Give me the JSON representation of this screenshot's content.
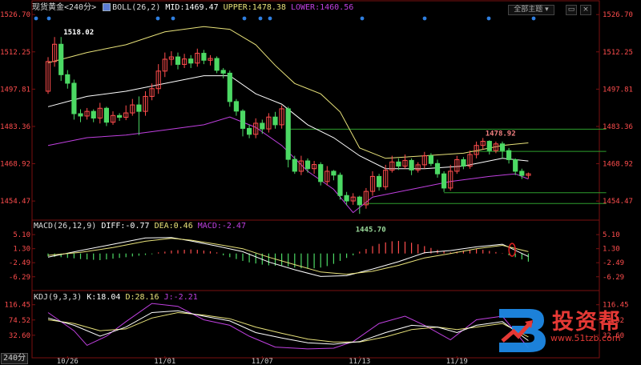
{
  "header": {
    "instrument": "现货黄金",
    "period": "<240分>",
    "indicator_label": "BOLL(26,2)",
    "mid": "MID:1469.47",
    "upper": "UPPER:1478.38",
    "lower": "LOWER:1460.56",
    "view_button": "全部主题",
    "period_tab": "240分"
  },
  "colors": {
    "up_candle": "#ff4d4d",
    "down_candle": "#4cd964",
    "boll_mid": "#ffffff",
    "boll_upper": "#e8e27a",
    "boll_lower": "#c040e0",
    "macd_diff": "#ffffff",
    "macd_dea": "#e8e27a",
    "kdj_k": "#ffffff",
    "kdj_d": "#e8e27a",
    "kdj_j": "#c040e0",
    "hline": "#2e9e2e",
    "axis_text": "#ff4d4d"
  },
  "chart_data": [
    {
      "type": "candlestick",
      "panel": "price",
      "ylim": [
        1448,
        1528
      ],
      "y_ticks": [
        1526.7,
        1512.25,
        1497.81,
        1483.36,
        1468.92,
        1454.47
      ],
      "x_labels": [
        "10/26",
        "11/01",
        "11/07",
        "11/13",
        "11/19"
      ],
      "x_label_index": [
        3,
        18,
        33,
        48,
        63
      ],
      "annotations": [
        {
          "text": "1518.02",
          "index": 2,
          "value": 1518.02
        },
        {
          "text": "1478.92",
          "index": 67,
          "value": 1478.92
        },
        {
          "text": "1445.70",
          "index": 47,
          "value": 1445.7
        }
      ],
      "hlines": [
        {
          "value": 1482.3,
          "from": 37,
          "to": 86
        },
        {
          "value": 1473.7,
          "from": 65,
          "to": 86
        },
        {
          "value": 1457.7,
          "from": 61,
          "to": 86
        },
        {
          "value": 1453.5,
          "from": 49,
          "to": 86
        }
      ],
      "candles": [
        [
          1497.0,
          1508.5,
          1497.0,
          1510.2,
          1496.0
        ],
        [
          1508.5,
          1515.2,
          1507.8,
          1518.0,
          1506.5
        ],
        [
          1515.2,
          1503.4,
          1502.6,
          1518.0,
          1501.0
        ],
        [
          1503.4,
          1500.1,
          1498.5,
          1505.2,
          1498.0
        ],
        [
          1500.1,
          1488.3,
          1487.0,
          1501.5,
          1486.0
        ],
        [
          1488.3,
          1487.4,
          1486.0,
          1490.0,
          1485.0
        ],
        [
          1487.4,
          1489.2,
          1486.8,
          1490.5,
          1486.0
        ],
        [
          1489.2,
          1486.6,
          1485.5,
          1490.0,
          1485.0
        ],
        [
          1486.6,
          1490.4,
          1485.8,
          1492.5,
          1484.5
        ],
        [
          1490.4,
          1485.0,
          1483.8,
          1491.0,
          1483.5
        ],
        [
          1485.0,
          1487.6,
          1484.5,
          1489.2,
          1484.0
        ],
        [
          1487.6,
          1486.9,
          1485.9,
          1488.5,
          1485.5
        ],
        [
          1486.9,
          1488.6,
          1486.2,
          1491.5,
          1485.8
        ],
        [
          1488.6,
          1491.7,
          1488.2,
          1494.0,
          1487.5
        ],
        [
          1491.7,
          1489.2,
          1488.8,
          1495.0,
          1480.0
        ],
        [
          1489.2,
          1495.0,
          1488.9,
          1497.0,
          1487.5
        ],
        [
          1495.0,
          1498.0,
          1494.2,
          1500.0,
          1493.5
        ],
        [
          1498.0,
          1504.8,
          1497.4,
          1507.5,
          1496.0
        ],
        [
          1504.8,
          1509.4,
          1503.6,
          1512.0,
          1502.5
        ],
        [
          1509.4,
          1510.3,
          1508.4,
          1512.5,
          1507.0
        ],
        [
          1510.3,
          1507.4,
          1506.1,
          1512.0,
          1505.5
        ],
        [
          1507.4,
          1509.5,
          1506.8,
          1511.5,
          1506.0
        ],
        [
          1509.5,
          1507.9,
          1506.8,
          1511.0,
          1506.0
        ],
        [
          1507.9,
          1511.7,
          1507.2,
          1513.5,
          1506.5
        ],
        [
          1511.7,
          1509.0,
          1508.1,
          1513.0,
          1507.5
        ],
        [
          1509.0,
          1509.7,
          1507.3,
          1511.0,
          1507.0
        ],
        [
          1509.7,
          1505.1,
          1504.5,
          1510.5,
          1504.0
        ],
        [
          1505.1,
          1504.0,
          1502.6,
          1506.0,
          1502.0
        ],
        [
          1504.0,
          1493.0,
          1492.2,
          1505.0,
          1491.0
        ],
        [
          1493.0,
          1489.3,
          1488.2,
          1494.0,
          1487.5
        ],
        [
          1489.3,
          1482.6,
          1481.7,
          1490.0,
          1479.5
        ],
        [
          1482.6,
          1480.3,
          1479.4,
          1484.0,
          1478.8
        ],
        [
          1480.3,
          1484.6,
          1479.5,
          1486.5,
          1478.8
        ],
        [
          1484.6,
          1482.4,
          1481.5,
          1486.0,
          1480.5
        ],
        [
          1482.4,
          1487.0,
          1481.8,
          1488.5,
          1481.0
        ],
        [
          1487.0,
          1484.0,
          1483.0,
          1489.0,
          1482.5
        ],
        [
          1484.0,
          1490.2,
          1483.4,
          1491.5,
          1482.5
        ],
        [
          1490.2,
          1470.6,
          1470.0,
          1491.0,
          1467.5
        ],
        [
          1470.6,
          1466.0,
          1465.4,
          1472.0,
          1465.0
        ],
        [
          1466.0,
          1470.0,
          1465.2,
          1472.0,
          1464.5
        ],
        [
          1470.0,
          1467.0,
          1466.3,
          1471.0,
          1465.5
        ],
        [
          1467.0,
          1468.6,
          1465.6,
          1470.0,
          1465.0
        ],
        [
          1468.6,
          1462.0,
          1461.4,
          1469.5,
          1460.5
        ],
        [
          1462.0,
          1466.0,
          1461.4,
          1468.0,
          1460.5
        ],
        [
          1466.0,
          1464.5,
          1463.1,
          1466.5,
          1462.5
        ],
        [
          1464.5,
          1456.6,
          1455.8,
          1465.5,
          1455.0
        ],
        [
          1456.6,
          1454.5,
          1453.5,
          1458.0,
          1452.8
        ],
        [
          1454.5,
          1456.0,
          1453.7,
          1457.5,
          1453.0
        ],
        [
          1456.0,
          1453.0,
          1452.5,
          1456.5,
          1449.5
        ],
        [
          1453.0,
          1458.2,
          1452.2,
          1459.5,
          1451.5
        ],
        [
          1458.2,
          1464.0,
          1457.6,
          1466.0,
          1456.5
        ],
        [
          1464.0,
          1460.0,
          1459.2,
          1465.0,
          1458.5
        ],
        [
          1460.0,
          1466.4,
          1459.7,
          1468.5,
          1458.8
        ],
        [
          1466.4,
          1469.6,
          1466.0,
          1472.0,
          1465.5
        ],
        [
          1469.6,
          1468.0,
          1467.5,
          1471.0,
          1466.5
        ],
        [
          1468.0,
          1470.2,
          1467.6,
          1472.5,
          1467.0
        ],
        [
          1470.2,
          1466.5,
          1465.5,
          1471.0,
          1464.5
        ],
        [
          1466.5,
          1468.5,
          1465.8,
          1469.5,
          1465.5
        ],
        [
          1468.5,
          1472.0,
          1467.6,
          1473.5,
          1467.0
        ],
        [
          1472.0,
          1469.0,
          1468.5,
          1473.0,
          1468.0
        ],
        [
          1469.0,
          1465.0,
          1464.2,
          1470.5,
          1463.5
        ],
        [
          1465.0,
          1459.5,
          1458.5,
          1466.0,
          1458.0
        ],
        [
          1459.5,
          1466.0,
          1459.4,
          1468.5,
          1458.5
        ],
        [
          1466.0,
          1470.5,
          1465.6,
          1472.0,
          1465.0
        ],
        [
          1470.5,
          1468.0,
          1467.0,
          1471.5,
          1466.8
        ],
        [
          1468.0,
          1472.5,
          1467.7,
          1474.0,
          1467.0
        ],
        [
          1472.5,
          1476.0,
          1471.8,
          1477.5,
          1471.0
        ],
        [
          1476.0,
          1477.6,
          1475.2,
          1478.9,
          1474.5
        ],
        [
          1477.6,
          1474.0,
          1473.0,
          1478.0,
          1472.5
        ],
        [
          1474.0,
          1476.6,
          1473.6,
          1477.5,
          1473.0
        ],
        [
          1476.6,
          1474.0,
          1473.4,
          1477.5,
          1471.0
        ],
        [
          1474.0,
          1470.5,
          1469.7,
          1475.0,
          1469.0
        ],
        [
          1470.5,
          1466.0,
          1465.0,
          1471.0,
          1464.5
        ],
        [
          1466.0,
          1464.4,
          1463.4,
          1467.0,
          1463.0
        ],
        [
          1464.4,
          1465.0,
          1463.5,
          1465.5,
          1463.2
        ]
      ],
      "boll_upper_points": [
        [
          0,
          1508
        ],
        [
          6,
          1512
        ],
        [
          12,
          1515
        ],
        [
          18,
          1520
        ],
        [
          24,
          1522
        ],
        [
          28,
          1521
        ],
        [
          32,
          1515
        ],
        [
          35,
          1507
        ],
        [
          38,
          1500
        ],
        [
          42,
          1496
        ],
        [
          45,
          1489
        ],
        [
          48,
          1475
        ],
        [
          52,
          1471
        ],
        [
          58,
          1472
        ],
        [
          64,
          1473
        ],
        [
          70,
          1476
        ],
        [
          74,
          1477
        ]
      ],
      "boll_mid_points": [
        [
          0,
          1491
        ],
        [
          6,
          1495
        ],
        [
          12,
          1497
        ],
        [
          18,
          1500
        ],
        [
          24,
          1503
        ],
        [
          28,
          1503
        ],
        [
          32,
          1496
        ],
        [
          36,
          1492
        ],
        [
          40,
          1484
        ],
        [
          44,
          1479
        ],
        [
          48,
          1472
        ],
        [
          52,
          1467
        ],
        [
          58,
          1467
        ],
        [
          64,
          1468
        ],
        [
          70,
          1471
        ],
        [
          74,
          1470
        ]
      ],
      "boll_lower_points": [
        [
          0,
          1476
        ],
        [
          6,
          1479
        ],
        [
          12,
          1480
        ],
        [
          18,
          1482
        ],
        [
          24,
          1484
        ],
        [
          28,
          1487
        ],
        [
          32,
          1483
        ],
        [
          36,
          1476
        ],
        [
          40,
          1466
        ],
        [
          44,
          1459
        ],
        [
          47,
          1450
        ],
        [
          50,
          1456
        ],
        [
          56,
          1459
        ],
        [
          62,
          1462
        ],
        [
          68,
          1464
        ],
        [
          72,
          1465
        ],
        [
          74,
          1463
        ]
      ]
    },
    {
      "type": "macd",
      "panel": "macd",
      "title": "MACD(26,12,9)",
      "diff_label": "DIFF:-0.77",
      "dea_label": "DEA:0.46",
      "macd_label": "MACD:-2.47",
      "ylim": [
        -8.5,
        7.5
      ],
      "y_ticks": [
        5.1,
        1.3,
        -2.49,
        -6.29
      ],
      "diff_points": [
        [
          0,
          -1
        ],
        [
          5,
          0.8
        ],
        [
          10,
          2.5
        ],
        [
          15,
          4.2
        ],
        [
          19,
          4.3
        ],
        [
          22,
          3.4
        ],
        [
          26,
          2.0
        ],
        [
          30,
          0.5
        ],
        [
          34,
          -2.3
        ],
        [
          38,
          -4.4
        ],
        [
          42,
          -6.2
        ],
        [
          46,
          -6.0
        ],
        [
          50,
          -4.2
        ],
        [
          54,
          -2.2
        ],
        [
          58,
          0.2
        ],
        [
          62,
          0.8
        ],
        [
          66,
          1.8
        ],
        [
          70,
          2.5
        ],
        [
          74,
          -0.8
        ]
      ],
      "dea_points": [
        [
          0,
          -0.5
        ],
        [
          5,
          0.3
        ],
        [
          10,
          1.6
        ],
        [
          15,
          3.3
        ],
        [
          19,
          4.1
        ],
        [
          22,
          3.6
        ],
        [
          26,
          2.5
        ],
        [
          30,
          1.3
        ],
        [
          34,
          -1.0
        ],
        [
          38,
          -3.0
        ],
        [
          42,
          -5.0
        ],
        [
          46,
          -5.6
        ],
        [
          50,
          -4.8
        ],
        [
          54,
          -3.2
        ],
        [
          58,
          -1.2
        ],
        [
          62,
          0.0
        ],
        [
          66,
          1.3
        ],
        [
          70,
          2.2
        ],
        [
          74,
          0.5
        ]
      ],
      "histogram": [
        -0.8,
        -0.9,
        -1.0,
        -1.2,
        -1.3,
        -1.5,
        -1.6,
        -1.7,
        -1.8,
        -1.6,
        -1.4,
        -1.2,
        -1.0,
        -0.8,
        -0.6,
        -0.4,
        -0.2,
        0.3,
        0.5,
        0.8,
        0.9,
        1.0,
        1.1,
        1.0,
        0.8,
        0.6,
        0.3,
        -0.5,
        -1.0,
        -1.5,
        -2.0,
        -2.4,
        -2.7,
        -3.0,
        -3.2,
        -3.3,
        -3.2,
        -3.5,
        -3.8,
        -4.0,
        -4.1,
        -4.0,
        -3.8,
        -3.4,
        -2.8,
        -2.0,
        -1.2,
        -0.5,
        0.5,
        1.2,
        2.0,
        2.6,
        3.0,
        3.3,
        3.4,
        3.2,
        2.9,
        2.5,
        2.0,
        1.5,
        1.0,
        0.6,
        0.3,
        0.5,
        0.8,
        1.0,
        1.2,
        1.0,
        0.7,
        0.4,
        0.1,
        -0.5,
        -1.0,
        -1.6,
        -2.2
      ]
    },
    {
      "type": "kdj",
      "panel": "kdj",
      "title": "KDJ(9,3,3)",
      "k_label": "K:18.04",
      "d_label": "D:28.16",
      "j_label": "J:-2.21",
      "ylim": [
        -25,
        140
      ],
      "y_ticks": [
        116.45,
        74.52,
        32.6
      ],
      "k_points": [
        [
          0,
          80
        ],
        [
          4,
          60
        ],
        [
          8,
          30
        ],
        [
          12,
          55
        ],
        [
          16,
          95
        ],
        [
          20,
          100
        ],
        [
          24,
          85
        ],
        [
          28,
          72
        ],
        [
          32,
          40
        ],
        [
          36,
          25
        ],
        [
          40,
          12
        ],
        [
          44,
          8
        ],
        [
          48,
          15
        ],
        [
          52,
          40
        ],
        [
          56,
          60
        ],
        [
          60,
          55
        ],
        [
          63,
          40
        ],
        [
          66,
          60
        ],
        [
          70,
          70
        ],
        [
          74,
          18
        ]
      ],
      "d_points": [
        [
          0,
          75
        ],
        [
          4,
          65
        ],
        [
          8,
          45
        ],
        [
          12,
          50
        ],
        [
          16,
          80
        ],
        [
          20,
          95
        ],
        [
          24,
          88
        ],
        [
          28,
          78
        ],
        [
          32,
          55
        ],
        [
          36,
          38
        ],
        [
          40,
          22
        ],
        [
          44,
          14
        ],
        [
          48,
          14
        ],
        [
          52,
          28
        ],
        [
          56,
          48
        ],
        [
          60,
          55
        ],
        [
          63,
          48
        ],
        [
          66,
          55
        ],
        [
          70,
          65
        ],
        [
          74,
          28
        ]
      ],
      "j_points": [
        [
          0,
          95
        ],
        [
          4,
          45
        ],
        [
          6,
          5
        ],
        [
          9,
          30
        ],
        [
          12,
          70
        ],
        [
          16,
          120
        ],
        [
          20,
          112
        ],
        [
          24,
          75
        ],
        [
          28,
          60
        ],
        [
          31,
          30
        ],
        [
          35,
          0
        ],
        [
          40,
          -5
        ],
        [
          44,
          -3
        ],
        [
          47,
          15
        ],
        [
          51,
          65
        ],
        [
          55,
          85
        ],
        [
          58,
          60
        ],
        [
          62,
          20
        ],
        [
          66,
          75
        ],
        [
          70,
          85
        ],
        [
          74,
          -2
        ]
      ]
    }
  ],
  "logo": {
    "text": "投资帮",
    "url": "www.51tzb.com"
  }
}
